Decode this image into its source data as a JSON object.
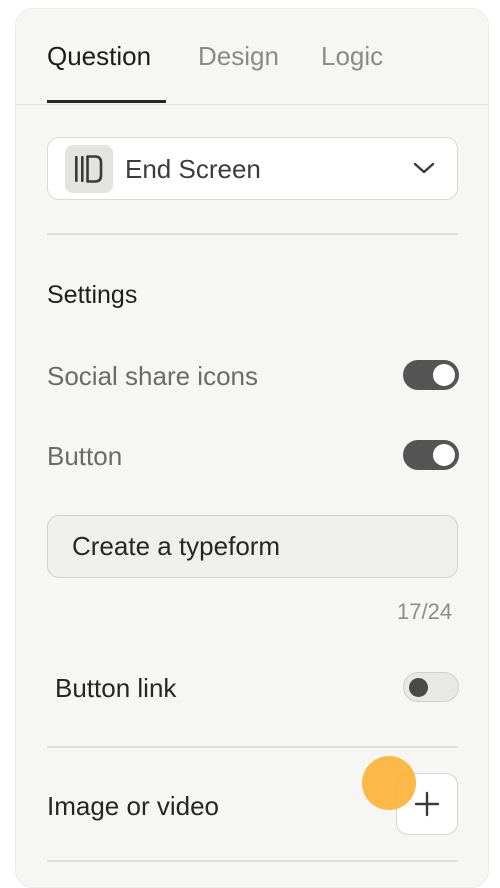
{
  "tabs": [
    {
      "label": "Question",
      "active": true
    },
    {
      "label": "Design",
      "active": false
    },
    {
      "label": "Logic",
      "active": false
    }
  ],
  "question_type": {
    "label": "End Screen",
    "icon": "end-screen-icon"
  },
  "settings": {
    "title": "Settings",
    "social_share_icons": {
      "label": "Social share icons",
      "enabled": true
    },
    "button": {
      "label": "Button",
      "enabled": true
    },
    "button_text": {
      "value": "Create a typeform",
      "counter": "17/24"
    },
    "button_link": {
      "label": "Button link",
      "enabled": false
    }
  },
  "image_or_video": {
    "label": "Image or video",
    "add_icon": "plus-icon"
  },
  "colors": {
    "toggle_on": "#555555",
    "toggle_off": "#e8e8e6",
    "cursor_highlight": "#fdb338"
  }
}
